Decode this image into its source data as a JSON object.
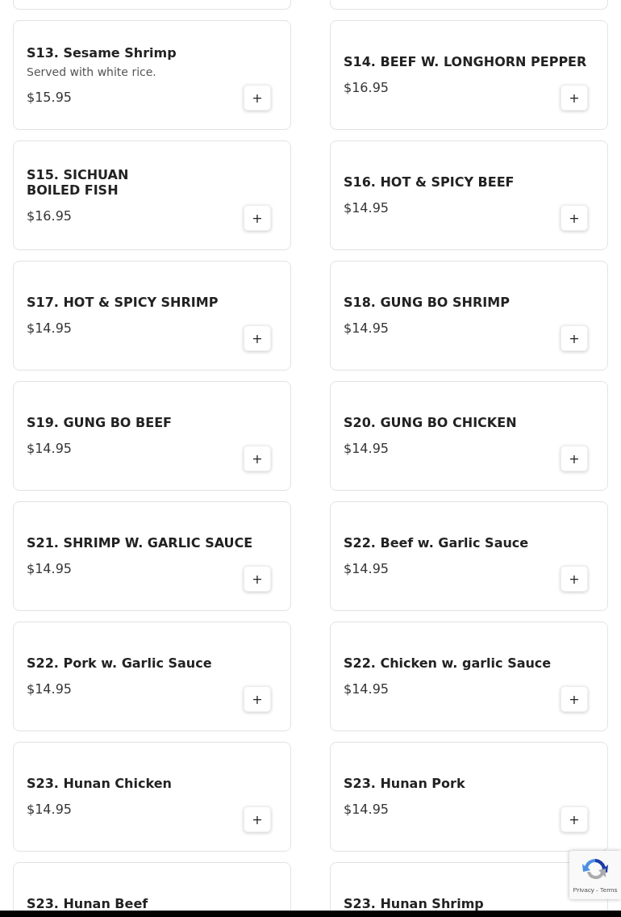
{
  "items": [
    {
      "title": "S13. Sesame Shrimp",
      "description": "Served with white rice.",
      "price": "$15.95",
      "add": "+"
    },
    {
      "title": "S14. BEEF W. LONGHORN PEPPER",
      "price": "$16.95",
      "add": "+"
    },
    {
      "title": "S15. SICHUAN\nBOILED FISH",
      "price": "$16.95",
      "add": "+"
    },
    {
      "title": "S16. HOT & SPICY BEEF",
      "price": "$14.95",
      "add": "+"
    },
    {
      "title": "S17. HOT & SPICY SHRIMP",
      "price": "$14.95",
      "add": "+"
    },
    {
      "title": "S18. GUNG BO SHRIMP",
      "price": "$14.95",
      "add": "+"
    },
    {
      "title": "S19. GUNG BO BEEF",
      "price": "$14.95",
      "add": "+"
    },
    {
      "title": "S20. GUNG BO CHICKEN",
      "price": "$14.95",
      "add": "+"
    },
    {
      "title": "S21. SHRIMP W. GARLIC SAUCE",
      "price": "$14.95",
      "add": "+"
    },
    {
      "title": "S22. Beef w. Garlic Sauce",
      "price": "$14.95",
      "add": "+"
    },
    {
      "title": "S22. Pork w. Garlic Sauce",
      "price": "$14.95",
      "add": "+"
    },
    {
      "title": "S22. Chicken w. garlic Sauce",
      "price": "$14.95",
      "add": "+"
    },
    {
      "title": "S23. Hunan Chicken",
      "price": "$14.95",
      "add": "+"
    },
    {
      "title": "S23. Hunan Pork",
      "price": "$14.95",
      "add": "+"
    },
    {
      "title": "S23. Hunan Beef"
    },
    {
      "title": "S23. Hunan Shrimp"
    }
  ],
  "recaptcha": {
    "links": "Privacy - Terms"
  }
}
